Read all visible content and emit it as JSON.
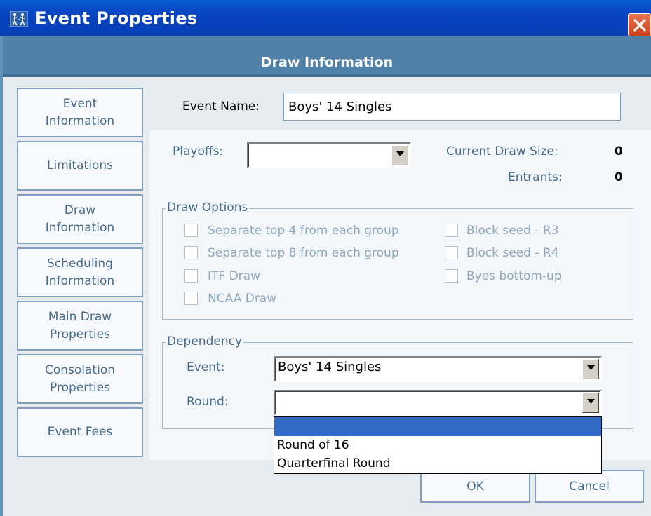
{
  "window": {
    "title": "Event Properties",
    "close_icon": "close-icon",
    "app_icon": "tennis-players-icon"
  },
  "header": {
    "title": "Draw Information"
  },
  "sidebar": {
    "items": [
      {
        "label": "Event\nInformation"
      },
      {
        "label": "Limitations"
      },
      {
        "label": "Draw\nInformation"
      },
      {
        "label": "Scheduling\nInformation"
      },
      {
        "label": "Main Draw\nProperties"
      },
      {
        "label": "Consolation\nProperties"
      },
      {
        "label": "Event Fees"
      }
    ]
  },
  "event_name": {
    "label": "Event Name:",
    "value": "Boys' 14 Singles"
  },
  "playoffs": {
    "label": "Playoffs:",
    "value": ""
  },
  "draw_size": {
    "label": "Current Draw Size:",
    "value": "0"
  },
  "entrants": {
    "label": "Entrants:",
    "value": "0"
  },
  "draw_options": {
    "title": "Draw Options",
    "left": [
      {
        "label": "Separate top 4 from each group",
        "checked": false
      },
      {
        "label": "Separate top 8 from each group",
        "checked": false
      },
      {
        "label": "ITF Draw",
        "checked": false
      },
      {
        "label": "NCAA Draw",
        "checked": false
      }
    ],
    "right": [
      {
        "label": "Block seed - R3",
        "checked": false
      },
      {
        "label": "Block seed - R4",
        "checked": false
      },
      {
        "label": "Byes bottom-up",
        "checked": false
      }
    ]
  },
  "dependency": {
    "title": "Dependency",
    "event_label": "Event:",
    "event_value": "Boys' 14 Singles",
    "round_label": "Round:",
    "round_value": "",
    "round_options": [
      "",
      "Round of 16",
      "Quarterfinal Round"
    ],
    "round_selected_index": 0
  },
  "buttons": {
    "ok": "OK",
    "cancel": "Cancel"
  },
  "colors": {
    "title_bar": "#0843C0",
    "header_band": "#5181A8",
    "frame": "#5F93B9",
    "selected_item": "#316AC5"
  }
}
